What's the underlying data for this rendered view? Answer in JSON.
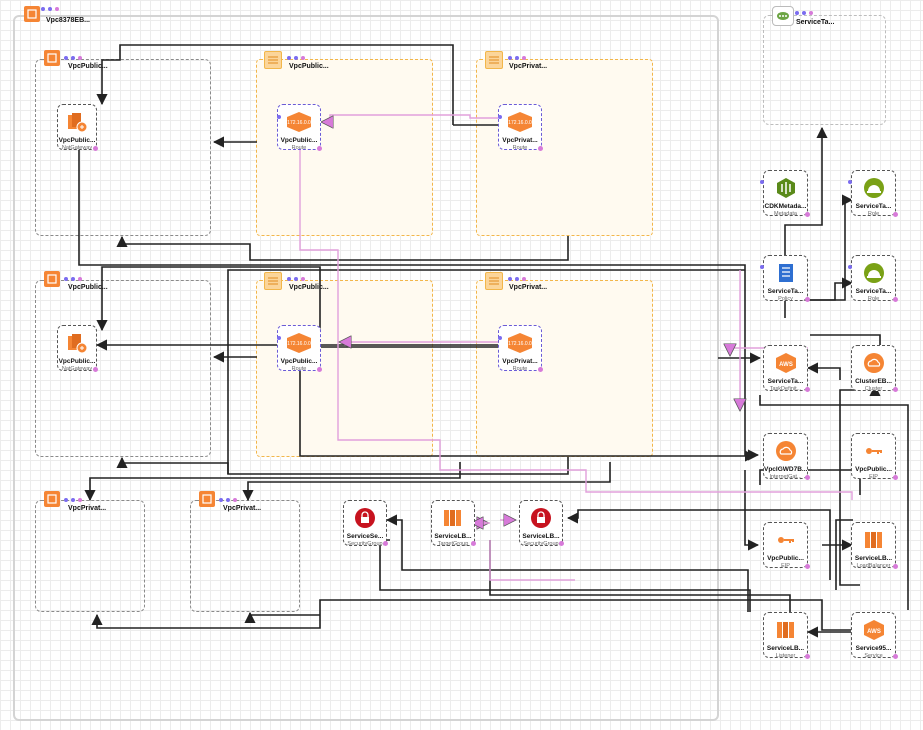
{
  "colors": {
    "ec2": "#f58534",
    "security": "#c7131f",
    "iam": "#7aa116",
    "edge": "#222222",
    "edge_pink": "#e2a0dc",
    "dots": "#7b6cf0"
  },
  "groups": {
    "vpc": "Vpc8378EB...",
    "service_group": "ServiceTa...",
    "az_public_1": "VpcPublic...",
    "az_public_2": "VpcPublic...",
    "az_private_1": "VpcPrivat...",
    "az_private_2": "VpcPrivat...",
    "subnet_public_1": "VpcPublic...",
    "subnet_private_1": "VpcPrivat...",
    "subnet_public_2": "VpcPublic...",
    "subnet_private_2": "VpcPrivat..."
  },
  "nodes": {
    "natgw1": {
      "name": "VpcPublic...",
      "type": "NatGateway",
      "icon": "nat-gateway-icon"
    },
    "natgw2": {
      "name": "VpcPublic...",
      "type": "NatGateway",
      "icon": "nat-gateway-icon"
    },
    "route_pub1": {
      "name": "VpcPublic...",
      "type": "Route",
      "badge": "172.16.0.0",
      "icon": "route-icon"
    },
    "route_priv1": {
      "name": "VpcPrivat...",
      "type": "Route",
      "badge": "172.16.0.0",
      "icon": "route-icon"
    },
    "route_pub2": {
      "name": "VpcPublic...",
      "type": "Route",
      "badge": "172.16.0.0",
      "icon": "route-icon"
    },
    "route_priv2": {
      "name": "VpcPrivat...",
      "type": "Route",
      "badge": "172.16.0.0",
      "icon": "route-icon"
    },
    "sg1": {
      "name": "ServiceSe...",
      "type": "SecurityGroup",
      "icon": "lock-icon"
    },
    "tg": {
      "name": "ServiceLB...",
      "type": "TargetGroup",
      "icon": "load-balancer-icon"
    },
    "sg2": {
      "name": "ServiceLB...",
      "type": "SecurityGroup",
      "icon": "lock-icon"
    },
    "cdk": {
      "name": "CDKMetada...",
      "type": "Metadata",
      "icon": "cdk-metadata-icon"
    },
    "role1": {
      "name": "ServiceTa...",
      "type": "Role",
      "icon": "hardhat-icon"
    },
    "policy": {
      "name": "ServiceTa...",
      "type": "Policy",
      "icon": "policy-document-icon"
    },
    "role2": {
      "name": "ServiceTa...",
      "type": "Role",
      "icon": "hardhat-icon"
    },
    "taskdef": {
      "name": "ServiceTa...",
      "type": "TaskDefinit...",
      "icon": "aws-icon"
    },
    "cluster": {
      "name": "ClusterEB...",
      "type": "Cluster",
      "icon": "cloud-icon"
    },
    "igw": {
      "name": "VpcIGWD7B...",
      "type": "InternetGat...",
      "icon": "cloud-icon"
    },
    "eip1": {
      "name": "VpcPublic...",
      "type": "EIP",
      "icon": "key-icon"
    },
    "eip2": {
      "name": "VpcPublic...",
      "type": "EIP",
      "icon": "key-icon"
    },
    "lb": {
      "name": "ServiceLB...",
      "type": "LoadBalancer",
      "icon": "load-balancer-icon"
    },
    "listener": {
      "name": "ServiceLB...",
      "type": "Listener",
      "icon": "load-balancer-icon"
    },
    "service": {
      "name": "Service95...",
      "type": "Service",
      "icon": "aws-icon"
    }
  }
}
